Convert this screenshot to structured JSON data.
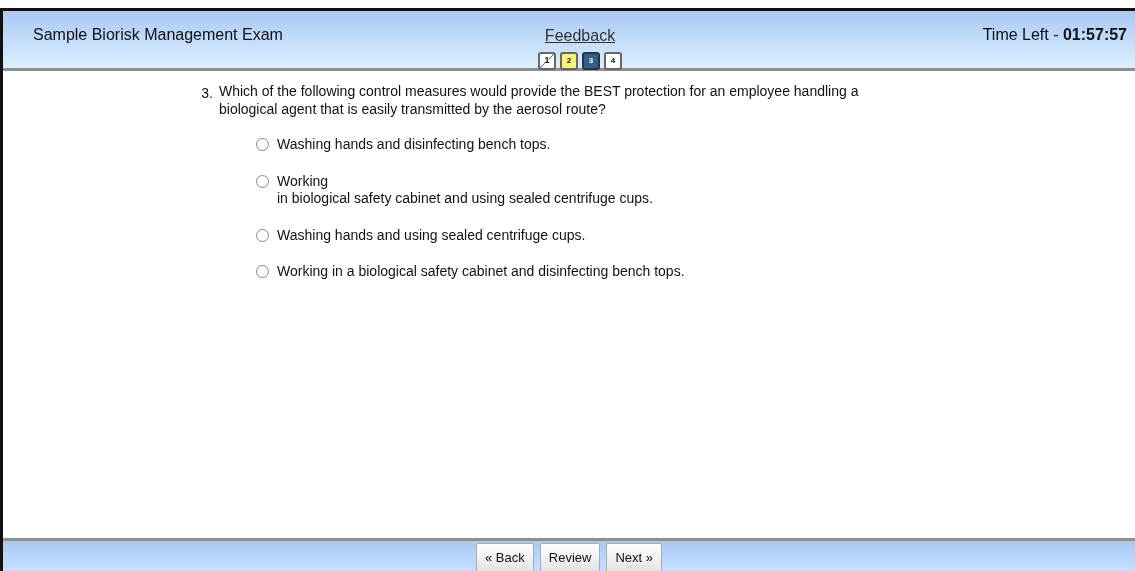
{
  "header": {
    "title": "Sample Biorisk Management Exam",
    "feedback_link": "Feedback",
    "time_left": "Time Left - **01:57:57**"
  },
  "navigator": [
    {
      "label": "1",
      "kind": "struck",
      "selected": false
    },
    {
      "label": "2",
      "kind": "marked",
      "selected": false
    },
    {
      "label": "3",
      "kind": "plain",
      "selected": true
    },
    {
      "label": "4",
      "kind": "plain",
      "selected": false
    }
  ],
  "question": {
    "number": "3.",
    "text": "Which of the following control measures would provide the BEST protection for an employee handling a biological agent that is easily transmitted by the aerosol route?",
    "options": [
      {
        "text": "Washing hands and disinfecting bench tops.",
        "selected": false
      },
      {
        "text": "Working\nin biological safety cabinet and using sealed centrifuge cups.",
        "selected": false
      },
      {
        "text": "Washing hands and using sealed centrifuge cups.",
        "selected": false
      },
      {
        "text": "Working in a biological safety cabinet and disinfecting bench tops.",
        "selected": false
      }
    ]
  },
  "footer": {
    "buttons": [
      "« Back",
      "Review",
      "Next »"
    ]
  }
}
